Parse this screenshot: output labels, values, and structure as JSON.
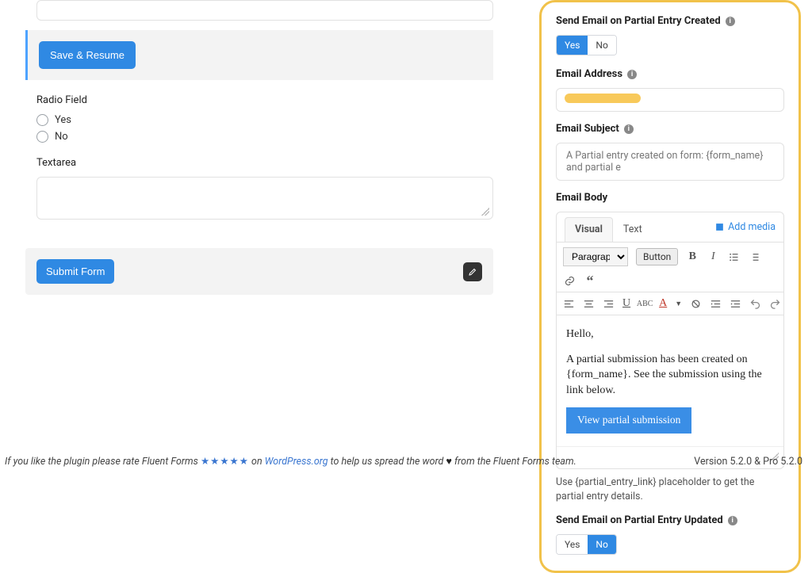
{
  "form": {
    "save_resume": "Save & Resume",
    "radio_label": "Radio Field",
    "radio_opts": [
      "Yes",
      "No"
    ],
    "textarea_label": "Textarea",
    "submit": "Submit Form"
  },
  "settings": {
    "created_label": "Send Email on Partial Entry Created",
    "created_choice": {
      "yes": "Yes",
      "no": "No",
      "value": "yes"
    },
    "email_addr_label": "Email Address",
    "subject_label": "Email Subject",
    "subject_value": "A Partial entry created on form: {form_name} and partial e",
    "body_label": "Email Body",
    "tabs": {
      "visual": "Visual",
      "text": "Text",
      "add_media": "Add media"
    },
    "toolbar": {
      "block": "Paragraph",
      "button": "Button"
    },
    "body": {
      "greet": "Hello,",
      "line": "A partial submission has been created on {form_name}. See the submission using the link below.",
      "button": "View partial submission"
    },
    "hint": "Use {partial_entry_link} placeholder to get the partial entry details.",
    "updated_label": "Send Email on Partial Entry Updated",
    "updated_choice": {
      "yes": "Yes",
      "no": "No",
      "value": "no"
    }
  },
  "footer": {
    "pre": "If you like the plugin please rate Fluent Forms ",
    "on": " on ",
    "wp": "WordPress.org",
    "post": " to help us spread the word ",
    "tail": " from the Fluent Forms team.",
    "version": "Version 5.2.0 & Pro 5.2.0"
  }
}
